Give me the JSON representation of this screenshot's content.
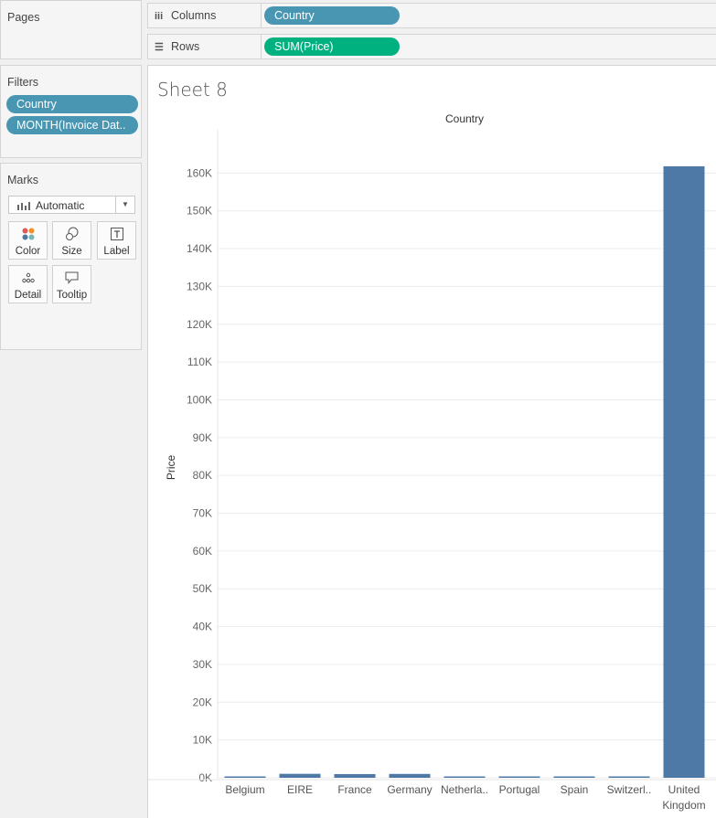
{
  "pages": {
    "title": "Pages"
  },
  "shelves": {
    "columns": {
      "label": "Columns",
      "pill": "Country"
    },
    "rows": {
      "label": "Rows",
      "pill": "SUM(Price)"
    }
  },
  "filters": {
    "title": "Filters",
    "items": [
      "Country",
      "MONTH(Invoice Dat.."
    ]
  },
  "marks": {
    "title": "Marks",
    "type": "Automatic",
    "buttons": {
      "color": "Color",
      "size": "Size",
      "label": "Label",
      "detail": "Detail",
      "tooltip": "Tooltip"
    }
  },
  "sheet": {
    "title": "Sheet 8",
    "header": "Country"
  },
  "colors": {
    "bar": "#4e79a7",
    "dimension_pill": "#4996b2",
    "measure_pill": "#00b180"
  },
  "chart_data": {
    "type": "bar",
    "title": "Sheet 8",
    "xlabel": "Country",
    "ylabel": "Price",
    "categories": [
      "Belgium",
      "EIRE",
      "France",
      "Germany",
      "Netherla..",
      "Portugal",
      "Spain",
      "Switzerl..",
      "United Kingdom"
    ],
    "values": [
      120,
      1050,
      980,
      1020,
      60,
      300,
      240,
      90,
      161800
    ],
    "ylim": [
      0,
      170000
    ],
    "yticks": [
      0,
      10000,
      20000,
      30000,
      40000,
      50000,
      60000,
      70000,
      80000,
      90000,
      100000,
      110000,
      120000,
      130000,
      140000,
      150000,
      160000
    ],
    "ytick_labels": [
      "0K",
      "10K",
      "20K",
      "30K",
      "40K",
      "50K",
      "60K",
      "70K",
      "80K",
      "90K",
      "100K",
      "110K",
      "120K",
      "130K",
      "140K",
      "150K",
      "160K"
    ],
    "grid": true
  }
}
